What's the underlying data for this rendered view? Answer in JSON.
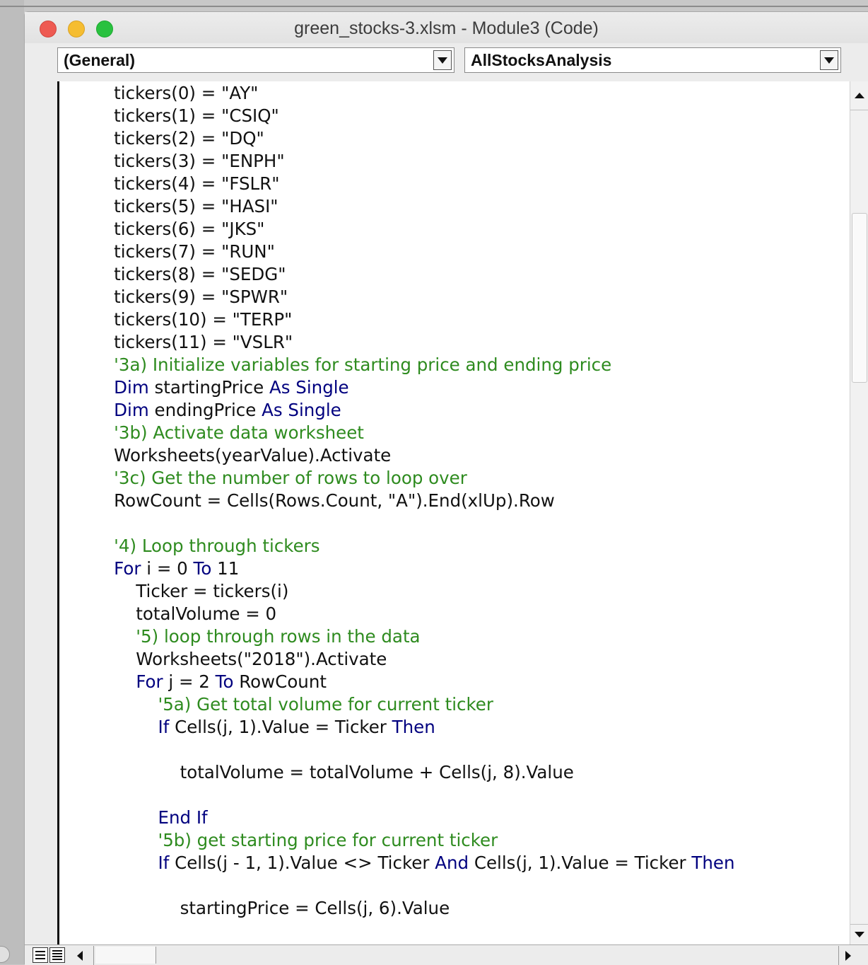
{
  "window": {
    "title": "green_stocks-3.xlsm - Module3 (Code)"
  },
  "toolbar": {
    "object_combo": "(General)",
    "procedure_combo": "AllStocksAnalysis"
  },
  "colors": {
    "keyword": "#00007f",
    "comment": "#2e8b1f",
    "text": "#111111",
    "close": "#ee5a52",
    "minimize": "#f5bd31",
    "zoom": "#29c13f"
  },
  "code_lines": [
    [
      {
        "t": "    tickers(0) = \"AY\"",
        "k": "tx"
      }
    ],
    [
      {
        "t": "    tickers(1) = \"CSIQ\"",
        "k": "tx"
      }
    ],
    [
      {
        "t": "    tickers(2) = \"DQ\"",
        "k": "tx"
      }
    ],
    [
      {
        "t": "    tickers(3) = \"ENPH\"",
        "k": "tx"
      }
    ],
    [
      {
        "t": "    tickers(4) = \"FSLR\"",
        "k": "tx"
      }
    ],
    [
      {
        "t": "    tickers(5) = \"HASI\"",
        "k": "tx"
      }
    ],
    [
      {
        "t": "    tickers(6) = \"JKS\"",
        "k": "tx"
      }
    ],
    [
      {
        "t": "    tickers(7) = \"RUN\"",
        "k": "tx"
      }
    ],
    [
      {
        "t": "    tickers(8) = \"SEDG\"",
        "k": "tx"
      }
    ],
    [
      {
        "t": "    tickers(9) = \"SPWR\"",
        "k": "tx"
      }
    ],
    [
      {
        "t": "    tickers(10) = \"TERP\"",
        "k": "tx"
      }
    ],
    [
      {
        "t": "    tickers(11) = \"VSLR\"",
        "k": "tx"
      }
    ],
    [
      {
        "t": "    '3a) Initialize variables for starting price and ending price",
        "k": "cm"
      }
    ],
    [
      {
        "t": "    ",
        "k": "tx"
      },
      {
        "t": "Dim",
        "k": "kw"
      },
      {
        "t": " startingPrice ",
        "k": "tx"
      },
      {
        "t": "As Single",
        "k": "kw"
      }
    ],
    [
      {
        "t": "    ",
        "k": "tx"
      },
      {
        "t": "Dim",
        "k": "kw"
      },
      {
        "t": " endingPrice ",
        "k": "tx"
      },
      {
        "t": "As Single",
        "k": "kw"
      }
    ],
    [
      {
        "t": "    '3b) Activate data worksheet",
        "k": "cm"
      }
    ],
    [
      {
        "t": "    Worksheets(yearValue).Activate",
        "k": "tx"
      }
    ],
    [
      {
        "t": "    '3c) Get the number of rows to loop over",
        "k": "cm"
      }
    ],
    [
      {
        "t": "    RowCount = Cells(Rows.Count, \"A\").End(xlUp).Row",
        "k": "tx"
      }
    ],
    [
      {
        "t": "",
        "k": "tx"
      }
    ],
    [
      {
        "t": "    '4) Loop through tickers",
        "k": "cm"
      }
    ],
    [
      {
        "t": "    ",
        "k": "tx"
      },
      {
        "t": "For",
        "k": "kw"
      },
      {
        "t": " i = 0 ",
        "k": "tx"
      },
      {
        "t": "To",
        "k": "kw"
      },
      {
        "t": " 11",
        "k": "tx"
      }
    ],
    [
      {
        "t": "        Ticker = tickers(i)",
        "k": "tx"
      }
    ],
    [
      {
        "t": "        totalVolume = 0",
        "k": "tx"
      }
    ],
    [
      {
        "t": "        '5) loop through rows in the data",
        "k": "cm"
      }
    ],
    [
      {
        "t": "        Worksheets(\"2018\").Activate",
        "k": "tx"
      }
    ],
    [
      {
        "t": "        ",
        "k": "tx"
      },
      {
        "t": "For",
        "k": "kw"
      },
      {
        "t": " j = 2 ",
        "k": "tx"
      },
      {
        "t": "To",
        "k": "kw"
      },
      {
        "t": " RowCount",
        "k": "tx"
      }
    ],
    [
      {
        "t": "            '5a) Get total volume for current ticker",
        "k": "cm"
      }
    ],
    [
      {
        "t": "            ",
        "k": "tx"
      },
      {
        "t": "If",
        "k": "kw"
      },
      {
        "t": " Cells(j, 1).Value = Ticker ",
        "k": "tx"
      },
      {
        "t": "Then",
        "k": "kw"
      }
    ],
    [
      {
        "t": "",
        "k": "tx"
      }
    ],
    [
      {
        "t": "                totalVolume = totalVolume + Cells(j, 8).Value",
        "k": "tx"
      }
    ],
    [
      {
        "t": "",
        "k": "tx"
      }
    ],
    [
      {
        "t": "            ",
        "k": "tx"
      },
      {
        "t": "End If",
        "k": "kw"
      }
    ],
    [
      {
        "t": "            '5b) get starting price for current ticker",
        "k": "cm"
      }
    ],
    [
      {
        "t": "            ",
        "k": "tx"
      },
      {
        "t": "If",
        "k": "kw"
      },
      {
        "t": " Cells(j - 1, 1).Value <> Ticker ",
        "k": "tx"
      },
      {
        "t": "And",
        "k": "kw"
      },
      {
        "t": " Cells(j, 1).Value = Ticker ",
        "k": "tx"
      },
      {
        "t": "Then",
        "k": "kw"
      }
    ],
    [
      {
        "t": "",
        "k": "tx"
      }
    ],
    [
      {
        "t": "                startingPrice = Cells(j, 6).Value",
        "k": "tx"
      }
    ]
  ]
}
